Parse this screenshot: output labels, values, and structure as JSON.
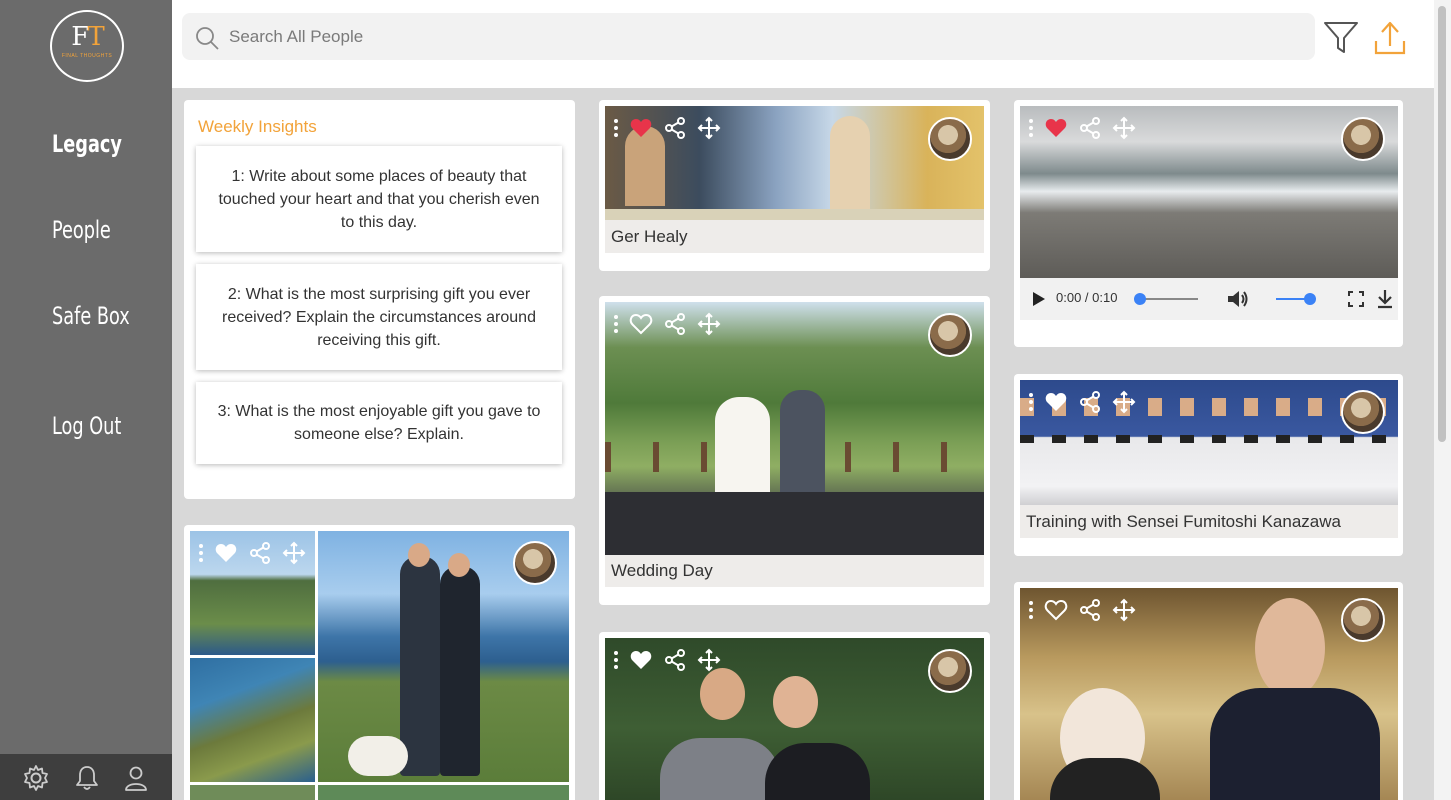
{
  "app": {
    "logo_text": "FT",
    "logo_letter_f": "F",
    "logo_letter_t": "T",
    "logo_subtitle": "FINAL THOUGHTS"
  },
  "sidebar": {
    "items": [
      {
        "label": "Legacy",
        "active": true
      },
      {
        "label": "People",
        "active": false
      },
      {
        "label": "Safe Box",
        "active": false
      },
      {
        "label": "Log Out",
        "active": false
      }
    ],
    "bottom_icons": [
      "gear-icon",
      "bell-icon",
      "user-icon"
    ]
  },
  "search": {
    "placeholder": "Search All People"
  },
  "header_icons": [
    "filter-icon",
    "upload-icon"
  ],
  "insights": {
    "title": "Weekly Insights",
    "items": [
      "1: Write about some places of beauty that touched your heart and that you cherish even to this day.",
      "2: What is the most surprising gift you ever received? Explain the circumstances around receiving this gift.",
      "3: What is the most enjoyable gift you gave to someone else? Explain."
    ]
  },
  "posts": [
    {
      "caption": "Ger Healy",
      "liked": true
    },
    {
      "caption": "",
      "liked": true,
      "video": {
        "time": "0:00 / 0:10",
        "progress": 0,
        "volume": 0.9
      }
    },
    {
      "caption": "Wedding Day",
      "liked": false
    },
    {
      "caption": "Training with Sensei Fumitoshi Kanazawa",
      "liked": false
    },
    {
      "caption": "",
      "liked": false
    },
    {
      "caption": "",
      "liked": false
    },
    {
      "caption": "",
      "liked": false
    }
  ],
  "colors": {
    "accent": "#f2a33a",
    "sidebar": "#6b6b6b",
    "like": "#e8344a",
    "slider": "#3b82f6"
  }
}
